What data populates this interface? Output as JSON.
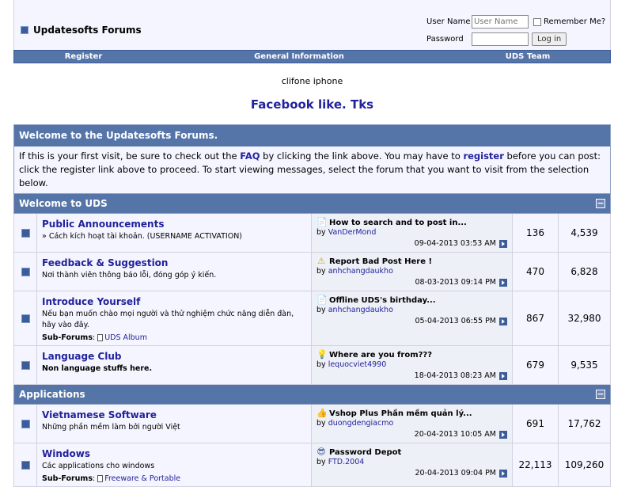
{
  "header": {
    "title": "Updatesofts Forums",
    "login": {
      "user_label": "User Name",
      "user_placeholder": "User Name",
      "remember_label": "Remember Me?",
      "password_label": "Password",
      "login_button": "Log in"
    }
  },
  "navbar": [
    "Register",
    "General Information",
    "UDS Team"
  ],
  "subheading1": "clifone iphone",
  "subheading2": "Facebook like. Tks",
  "welcome": {
    "title": "Welcome to the Updatesofts Forums.",
    "text_1": "If this is your first visit, be sure to check out the ",
    "faq": "FAQ",
    "text_2": " by clicking the link above. You may have to ",
    "register": "register",
    "text_3": " before you can post: click the register link above to proceed. To start viewing messages, select the forum that you want to visit from the selection below."
  },
  "categories": [
    {
      "title": "Welcome to UDS",
      "collapse": "−",
      "forums": [
        {
          "name": "Public Announcements",
          "desc": "» Cách kích hoạt tài khoản. (USERNAME ACTIVATION)",
          "desc_bold": false,
          "subforum_label": "",
          "subforum": "",
          "last_icon": "doc",
          "last_title": "How to search and to post in...",
          "by": "by",
          "last_user": "VanDerMond",
          "last_date": "09-04-2013 03:53 AM",
          "threads": "136",
          "posts": "4,539"
        },
        {
          "name": "Feedback & Suggestion",
          "desc": "Nơi thành viên thông báo lỗi, đóng góp ý kiến.",
          "desc_bold": false,
          "subforum_label": "",
          "subforum": "",
          "last_icon": "warn",
          "last_title": "Report Bad Post Here !",
          "by": "by",
          "last_user": "anhchangdaukho",
          "last_date": "08-03-2013 09:14 PM",
          "threads": "470",
          "posts": "6,828"
        },
        {
          "name": "Introduce Yourself",
          "desc": "Nếu bạn muốn chào mọi người và thử nghiệm chức năng diễn đàn, hãy vào đây.",
          "desc_bold": false,
          "subforum_label": "Sub-Forums",
          "subforum": "UDS Album",
          "last_icon": "doc",
          "last_title": "Offline UDS's birthday...",
          "by": "by",
          "last_user": "anhchangdaukho",
          "last_date": "05-04-2013 06:55 PM",
          "threads": "867",
          "posts": "32,980"
        },
        {
          "name": "Language Club",
          "desc": "Non language stuffs here.",
          "desc_bold": true,
          "subforum_label": "",
          "subforum": "",
          "last_icon": "bulb",
          "last_title": "Where are you from???",
          "by": "by",
          "last_user": "lequocviet4990",
          "last_date": "18-04-2013 08:23 AM",
          "threads": "679",
          "posts": "9,535"
        }
      ]
    },
    {
      "title": "Applications",
      "collapse": "−",
      "forums": [
        {
          "name": "Vietnamese Software",
          "desc": "Những phần mềm làm bởi người Việt",
          "desc_bold": false,
          "subforum_label": "",
          "subforum": "",
          "last_icon": "thumb",
          "last_title": "Vshop Plus Phần mềm quản lý...",
          "by": "by",
          "last_user": "duongdengiacmo",
          "last_date": "20-04-2013 10:05 AM",
          "threads": "691",
          "posts": "17,762"
        },
        {
          "name": "Windows",
          "desc": "Các applications cho windows",
          "desc_bold": false,
          "subforum_label": "Sub-Forums",
          "subforum": "Freeware & Portable",
          "last_icon": "cool",
          "last_title": "Password Depot",
          "by": "by",
          "last_user": "FTD.2004",
          "last_date": "20-04-2013 09:04 PM",
          "threads": "22,113",
          "posts": "109,260"
        }
      ]
    }
  ]
}
